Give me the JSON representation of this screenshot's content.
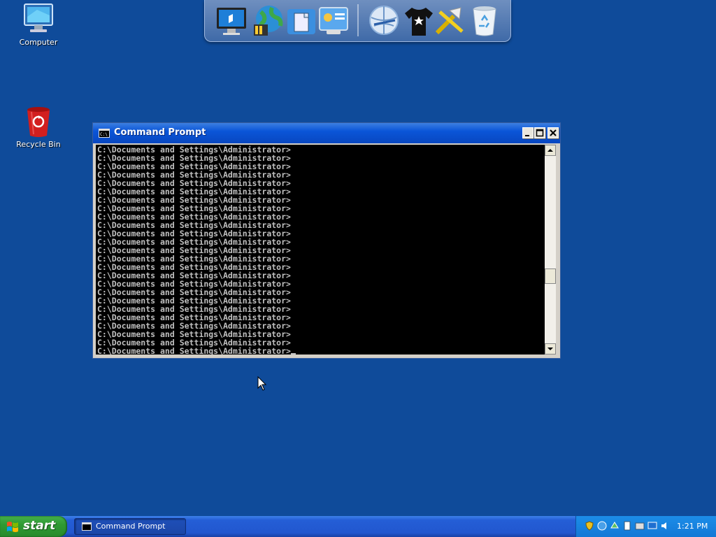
{
  "desktop": {
    "icons": [
      {
        "label": "Computer"
      },
      {
        "label": "Recycle Bin"
      }
    ]
  },
  "dock": {
    "items": [
      "monitor-icon",
      "globe-icon",
      "documents-icon",
      "control-panel-icon",
      "internet-icon",
      "tshirt-icon",
      "tools-icon",
      "recycle-bin-icon"
    ]
  },
  "window": {
    "title": "Command Prompt",
    "lines": [
      "C:\\Documents and Settings\\Administrator>",
      "C:\\Documents and Settings\\Administrator>",
      "C:\\Documents and Settings\\Administrator>",
      "C:\\Documents and Settings\\Administrator>",
      "C:\\Documents and Settings\\Administrator>",
      "C:\\Documents and Settings\\Administrator>",
      "C:\\Documents and Settings\\Administrator>",
      "C:\\Documents and Settings\\Administrator>",
      "C:\\Documents and Settings\\Administrator>",
      "C:\\Documents and Settings\\Administrator>",
      "C:\\Documents and Settings\\Administrator>",
      "C:\\Documents and Settings\\Administrator>",
      "C:\\Documents and Settings\\Administrator>",
      "C:\\Documents and Settings\\Administrator>",
      "C:\\Documents and Settings\\Administrator>",
      "C:\\Documents and Settings\\Administrator>",
      "C:\\Documents and Settings\\Administrator>",
      "C:\\Documents and Settings\\Administrator>",
      "C:\\Documents and Settings\\Administrator>",
      "C:\\Documents and Settings\\Administrator>",
      "C:\\Documents and Settings\\Administrator>",
      "C:\\Documents and Settings\\Administrator>",
      "C:\\Documents and Settings\\Administrator>",
      "C:\\Documents and Settings\\Administrator>",
      "C:\\Documents and Settings\\Administrator>"
    ]
  },
  "taskbar": {
    "start_label": "start",
    "task_label": "Command Prompt",
    "clock": "1:21 PM"
  }
}
